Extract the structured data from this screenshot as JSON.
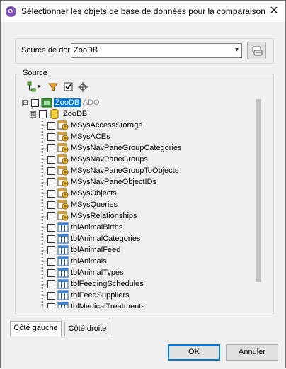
{
  "window": {
    "title": "Sélectionner les objets de base de données pour la comparaison",
    "close_glyph": "✕"
  },
  "source_row": {
    "label": "Source de dor",
    "combo_value": "ZooDB",
    "combo_arrow": "▾"
  },
  "source_group": {
    "label": "Source"
  },
  "tree": {
    "root": {
      "label": "ZooDB",
      "suffix": "ADO",
      "expander": "⊟"
    },
    "db": {
      "label": "ZooDB",
      "expander": "⊟"
    },
    "items": [
      {
        "label": "MSysAccessStorage",
        "kind": "system-table"
      },
      {
        "label": "MSysACEs",
        "kind": "system-table"
      },
      {
        "label": "MSysNavPaneGroupCategories",
        "kind": "system-table"
      },
      {
        "label": "MSysNavPaneGroups",
        "kind": "system-table"
      },
      {
        "label": "MSysNavPaneGroupToObjects",
        "kind": "system-table"
      },
      {
        "label": "MSysNavPaneObjectIDs",
        "kind": "system-table"
      },
      {
        "label": "MSysObjects",
        "kind": "system-table"
      },
      {
        "label": "MSysQueries",
        "kind": "system-table"
      },
      {
        "label": "MSysRelationships",
        "kind": "system-table"
      },
      {
        "label": "tblAnimalBirths",
        "kind": "table"
      },
      {
        "label": "tblAnimalCategories",
        "kind": "table"
      },
      {
        "label": "tblAnimalFeed",
        "kind": "table"
      },
      {
        "label": "tblAnimals",
        "kind": "table"
      },
      {
        "label": "tblAnimalTypes",
        "kind": "table"
      },
      {
        "label": "tblFeedingSchedules",
        "kind": "table"
      },
      {
        "label": "tblFeedSuppliers",
        "kind": "table"
      },
      {
        "label": "tblMedicalTreatments",
        "kind": "table"
      }
    ]
  },
  "tabs": {
    "left": "Côté gauche",
    "right": "Côté droite"
  },
  "buttons": {
    "ok": "OK",
    "cancel": "Annuler"
  },
  "colors": {
    "selection": "#0078d7",
    "default_button_border": "#0078d7"
  }
}
